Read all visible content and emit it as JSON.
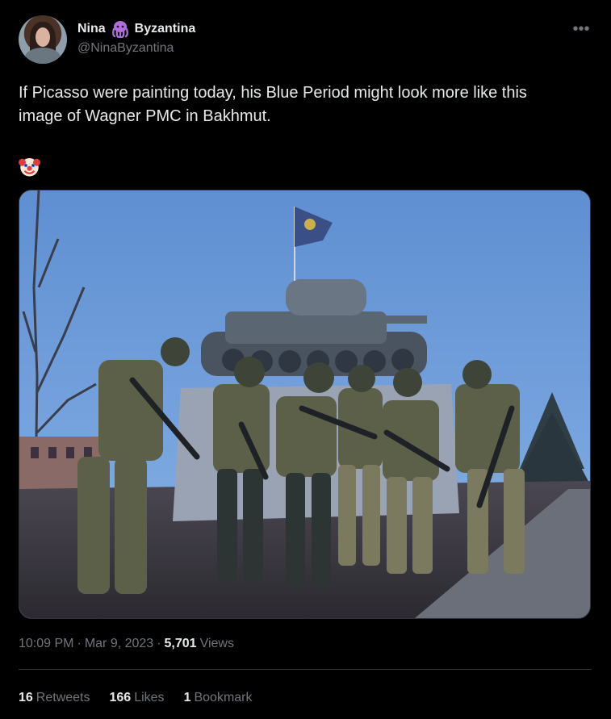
{
  "author": {
    "name_first": "Nina",
    "name_emoji": "octopus",
    "name_last": "Byzantina",
    "handle": "@NinaByzantina"
  },
  "more_icon": "more-horizontal-icon",
  "tweet": {
    "text": "If Picasso were painting today, his Blue Period might look more like this\nimage of Wagner PMC in Bakhmut.",
    "emoji": "clown-face"
  },
  "meta": {
    "time": "10:09 PM",
    "separator": "·",
    "date": "Mar 9, 2023",
    "separator2": "·",
    "views_count": "5,701",
    "views_label": "Views"
  },
  "stats": [
    {
      "count": "16",
      "label": "Retweets"
    },
    {
      "count": "166",
      "label": "Likes"
    },
    {
      "count": "1",
      "label": "Bookmark"
    }
  ],
  "colors": {
    "background": "#000000",
    "text": "#e7e9ea",
    "muted": "#71767b",
    "divider": "#2f3336",
    "sky": "#6d9ad0"
  }
}
